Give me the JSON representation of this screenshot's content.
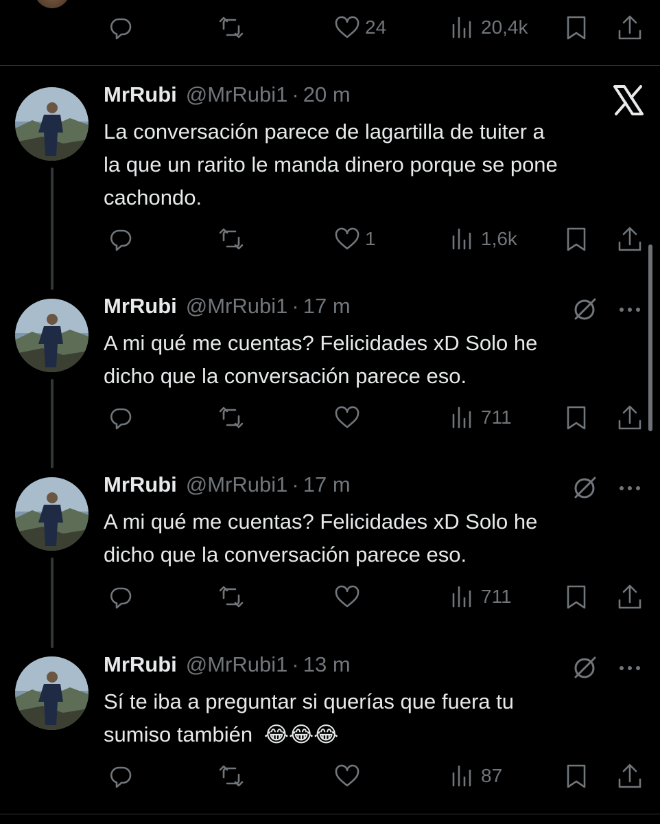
{
  "colors": {
    "background": "#000000",
    "text": "#e7e9ea",
    "muted": "#71767b",
    "divider": "#2f3336"
  },
  "icons": [
    "reply-icon",
    "retweet-icon",
    "like-icon",
    "views-icon",
    "bookmark-icon",
    "share-icon",
    "x-logo-icon",
    "grok-icon",
    "more-icon",
    "emoji-icon"
  ],
  "top_tweet": {
    "likes": "24",
    "views": "20,4k"
  },
  "tweets": [
    {
      "name": "MrRubi",
      "handle": "@MrRubi1",
      "sep": "·",
      "time": "20 m",
      "lines": [
        "La conversación parece de lagartilla de tuiter a",
        "la que un rarito le manda dinero porque se pone",
        "cachondo."
      ],
      "likes": "1",
      "views": "1,6k"
    },
    {
      "name": "MrRubi",
      "handle": "@MrRubi1",
      "sep": "·",
      "time": "17 m",
      "lines": [
        "A mi qué me cuentas? Felicidades xD Solo he",
        "dicho que la conversación parece eso."
      ],
      "likes": "",
      "views": "711"
    },
    {
      "name": "MrRubi",
      "handle": "@MrRubi1",
      "sep": "·",
      "time": "17 m",
      "lines": [
        "A mi qué me cuentas? Felicidades xD Solo he",
        "dicho que la conversación parece eso."
      ],
      "likes": "",
      "views": "711"
    },
    {
      "name": "MrRubi",
      "handle": "@MrRubi1",
      "sep": "·",
      "time": "13 m",
      "lines": [
        "Sí te iba a preguntar si querías que fuera tu",
        "sumiso también"
      ],
      "emojis": "😂😂😂",
      "likes": "",
      "views": "87"
    }
  ]
}
